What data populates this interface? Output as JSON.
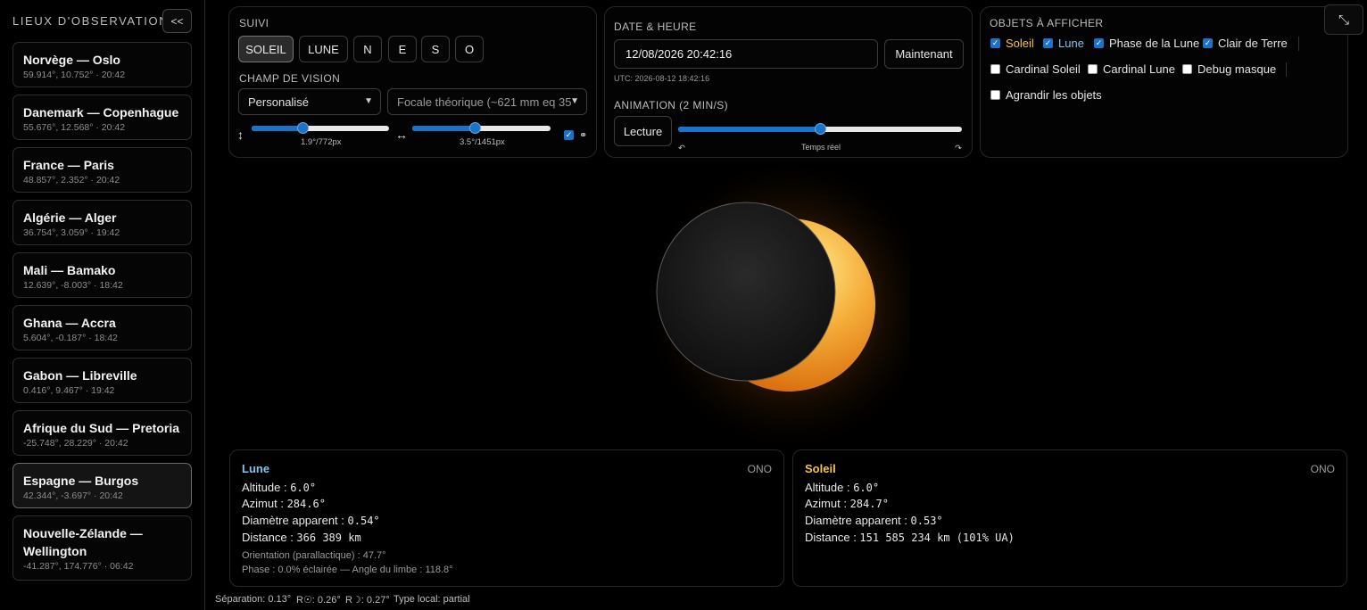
{
  "sidebar": {
    "title": "LIEUX D'OBSERVATION",
    "collapse_label": "<<",
    "locations": [
      {
        "name": "Norvège — Oslo",
        "info": "59.914°, 10.752° · 20:42"
      },
      {
        "name": "Danemark — Copenhague",
        "info": "55.676°, 12.568° · 20:42"
      },
      {
        "name": "France — Paris",
        "info": "48.857°, 2.352° · 20:42"
      },
      {
        "name": "Algérie — Alger",
        "info": "36.754°, 3.059° · 19:42"
      },
      {
        "name": "Mali — Bamako",
        "info": "12.639°, -8.003° · 18:42"
      },
      {
        "name": "Ghana — Accra",
        "info": "5.604°, -0.187° · 18:42"
      },
      {
        "name": "Gabon — Libreville",
        "info": "0.416°, 9.467° · 19:42"
      },
      {
        "name": "Afrique du Sud — Pretoria",
        "info": "-25.748°, 28.229° · 20:42"
      },
      {
        "name": "Espagne — Burgos",
        "info": "42.344°, -3.697° · 20:42"
      },
      {
        "name": "Nouvelle-Zélande — Wellington",
        "info": "-41.287°, 174.776° · 06:42"
      }
    ]
  },
  "suivi": {
    "title": "SUIVI",
    "buttons": [
      "SOLEIL",
      "LUNE",
      "N",
      "E",
      "S",
      "O"
    ],
    "active": "SOLEIL"
  },
  "fov": {
    "title": "CHAMP DE VISION",
    "preset": "Personalisé",
    "focal": "Focale théorique (~621 mm eq 35",
    "vertical_label": "1.9°/772px",
    "horizontal_label": "3.5°/1451px",
    "vertical_level": 0.37,
    "horizontal_level": 0.45,
    "link_checked": true,
    "vertical_icon": "↕",
    "horizontal_icon": "↔",
    "link_icon": "⚭"
  },
  "datetime": {
    "title": "DATE & HEURE",
    "value": "12/08/2026 20:42:16",
    "now_button": "Maintenant",
    "utc": "UTC: 2026-08-12 18:42:16"
  },
  "animation": {
    "title": "ANIMATION (2 MIN/S)",
    "play_button": "Lecture",
    "center_label": "Temps réel",
    "level": 0.5,
    "left_icon": "↶",
    "right_icon": "↷"
  },
  "objects": {
    "title": "OBJETS À AFFICHER",
    "items": [
      {
        "label": "Soleil",
        "checked": true,
        "color": "#f5c542"
      },
      {
        "label": "Lune",
        "checked": true,
        "color": "#7fc4ee"
      },
      {
        "label": "Phase de la Lune",
        "checked": true
      },
      {
        "label": "Clair de Terre",
        "checked": true
      },
      {
        "label": "Cardinal Soleil",
        "checked": false
      },
      {
        "label": "Cardinal Lune",
        "checked": false
      },
      {
        "label": "Debug masque",
        "checked": false
      },
      {
        "label": "Agrandir les objets",
        "checked": false
      }
    ],
    "fullscreen_icon": "⤡"
  },
  "lune": {
    "name": "Lune",
    "dir": "ONO",
    "altitude_label": "Altitude : ",
    "altitude": "6.0°",
    "azimut_label": "Azimut : ",
    "azimut": "284.6°",
    "diam_label": "Diamètre apparent : ",
    "diam": "0.54°",
    "dist_label": "Distance : ",
    "dist": "366 389 km",
    "orientation": "Orientation (parallactique) : 47.7°",
    "phase": "Phase : 0.0% éclairée — Angle du limbe : 118.8°",
    "color": "#7fc4ee"
  },
  "soleil": {
    "name": "Soleil",
    "dir": "ONO",
    "altitude_label": "Altitude : ",
    "altitude": "6.0°",
    "azimut_label": "Azimut : ",
    "azimut": "284.7°",
    "diam_label": "Diamètre apparent : ",
    "diam": "0.53°",
    "dist_label": "Distance : ",
    "dist": "151 585 234 km (101% UA)",
    "color": "#f5c542"
  },
  "status": {
    "separation": "Séparation: 0.13°",
    "r_sun": "R☉: 0.26°",
    "r_moon": "R☽: 0.27°",
    "type": "Type local: partial"
  }
}
